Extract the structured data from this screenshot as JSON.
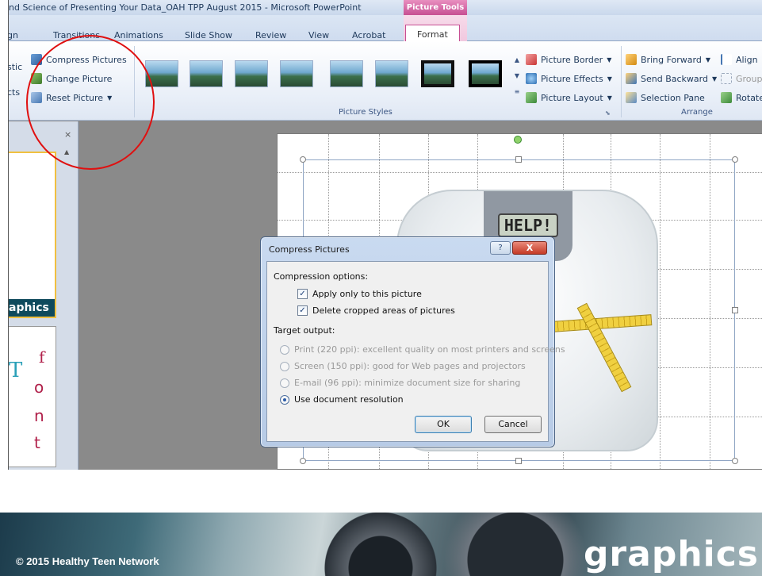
{
  "window": {
    "title": "nd Science of Presenting Your Data_OAH TPP August 2015  -  Microsoft PowerPoint",
    "context_tab": "Picture Tools"
  },
  "tabs": [
    "gn",
    "Transitions",
    "Animations",
    "Slide Show",
    "Review",
    "View",
    "Acrobat",
    "Format"
  ],
  "active_tab": "Format",
  "ribbon": {
    "adjust": {
      "compress": "Compress Pictures",
      "change": "Change Picture",
      "reset": "Reset Picture",
      "partial_top": "stic",
      "partial_bottom": "cts"
    },
    "picture_styles": {
      "label": "Picture Styles",
      "border": "Picture Border",
      "effects": "Picture Effects",
      "layout": "Picture Layout"
    },
    "arrange": {
      "label": "Arrange",
      "bring_forward": "Bring Forward",
      "send_backward": "Send Backward",
      "selection_pane": "Selection Pane",
      "align": "Align",
      "group": "Group",
      "rotate": "Rotate"
    }
  },
  "slides_panel": {
    "close": "×",
    "slide1_caption": "aphics",
    "slide2_letters": [
      "f",
      "T",
      "o",
      "n",
      "t"
    ]
  },
  "picture": {
    "lcd_text": "HELP!"
  },
  "dialog": {
    "title": "Compress Pictures",
    "help": "?",
    "close": "X",
    "compression_header": "Compression options:",
    "apply_only": "Apply only to this picture",
    "delete_cropped": "Delete cropped areas of pictures",
    "target_header": "Target output:",
    "options": [
      {
        "label": "Print (220 ppi): excellent quality on most printers and screens",
        "enabled": false,
        "selected": false
      },
      {
        "label": "Screen (150 ppi): good for Web pages and projectors",
        "enabled": false,
        "selected": false
      },
      {
        "label": "E-mail (96 ppi): minimize document size for sharing",
        "enabled": false,
        "selected": false
      },
      {
        "label": "Use document resolution",
        "enabled": true,
        "selected": true
      }
    ],
    "ok": "OK",
    "cancel": "Cancel"
  },
  "footer": {
    "copyright": "© 2015 Healthy Teen Network",
    "title": "graphics"
  }
}
